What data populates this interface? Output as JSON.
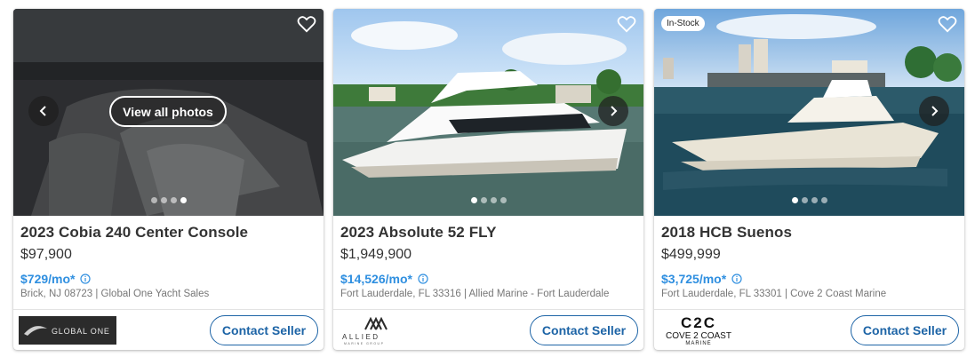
{
  "listings": [
    {
      "title": "2023 Cobia 240 Center Console",
      "price": "$97,900",
      "monthly": "$729/mo*",
      "location": "Brick, NJ 08723 | Global One Yacht Sales",
      "view_all_label": "View all photos",
      "photo_count": 4,
      "active_photo": 4,
      "contact_label": "Contact Seller",
      "dealer_logo_text": "GLOBAL ONE"
    },
    {
      "title": "2023 Absolute 52 FLY",
      "price": "$1,949,900",
      "monthly": "$14,526/mo*",
      "location": "Fort Lauderdale, FL 33316 | Allied Marine - Fort Lauderdale",
      "photo_count": 4,
      "active_photo": 1,
      "contact_label": "Contact Seller",
      "dealer_logo_text": "ALLIED",
      "dealer_logo_subtext": "MARINE GROUP"
    },
    {
      "title": "2018 HCB Suenos",
      "price": "$499,999",
      "monthly": "$3,725/mo*",
      "location": "Fort Lauderdale, FL 33301 | Cove 2 Coast Marine",
      "badge": "In-Stock",
      "photo_count": 4,
      "active_photo": 1,
      "contact_label": "Contact Seller",
      "dealer_logo_text": "C2C",
      "dealer_logo_line2": "COVE 2 COAST",
      "dealer_logo_line3": "MARINE"
    }
  ],
  "colors": {
    "accent_blue": "#2f8fe0",
    "button_blue": "#1d64a6"
  }
}
